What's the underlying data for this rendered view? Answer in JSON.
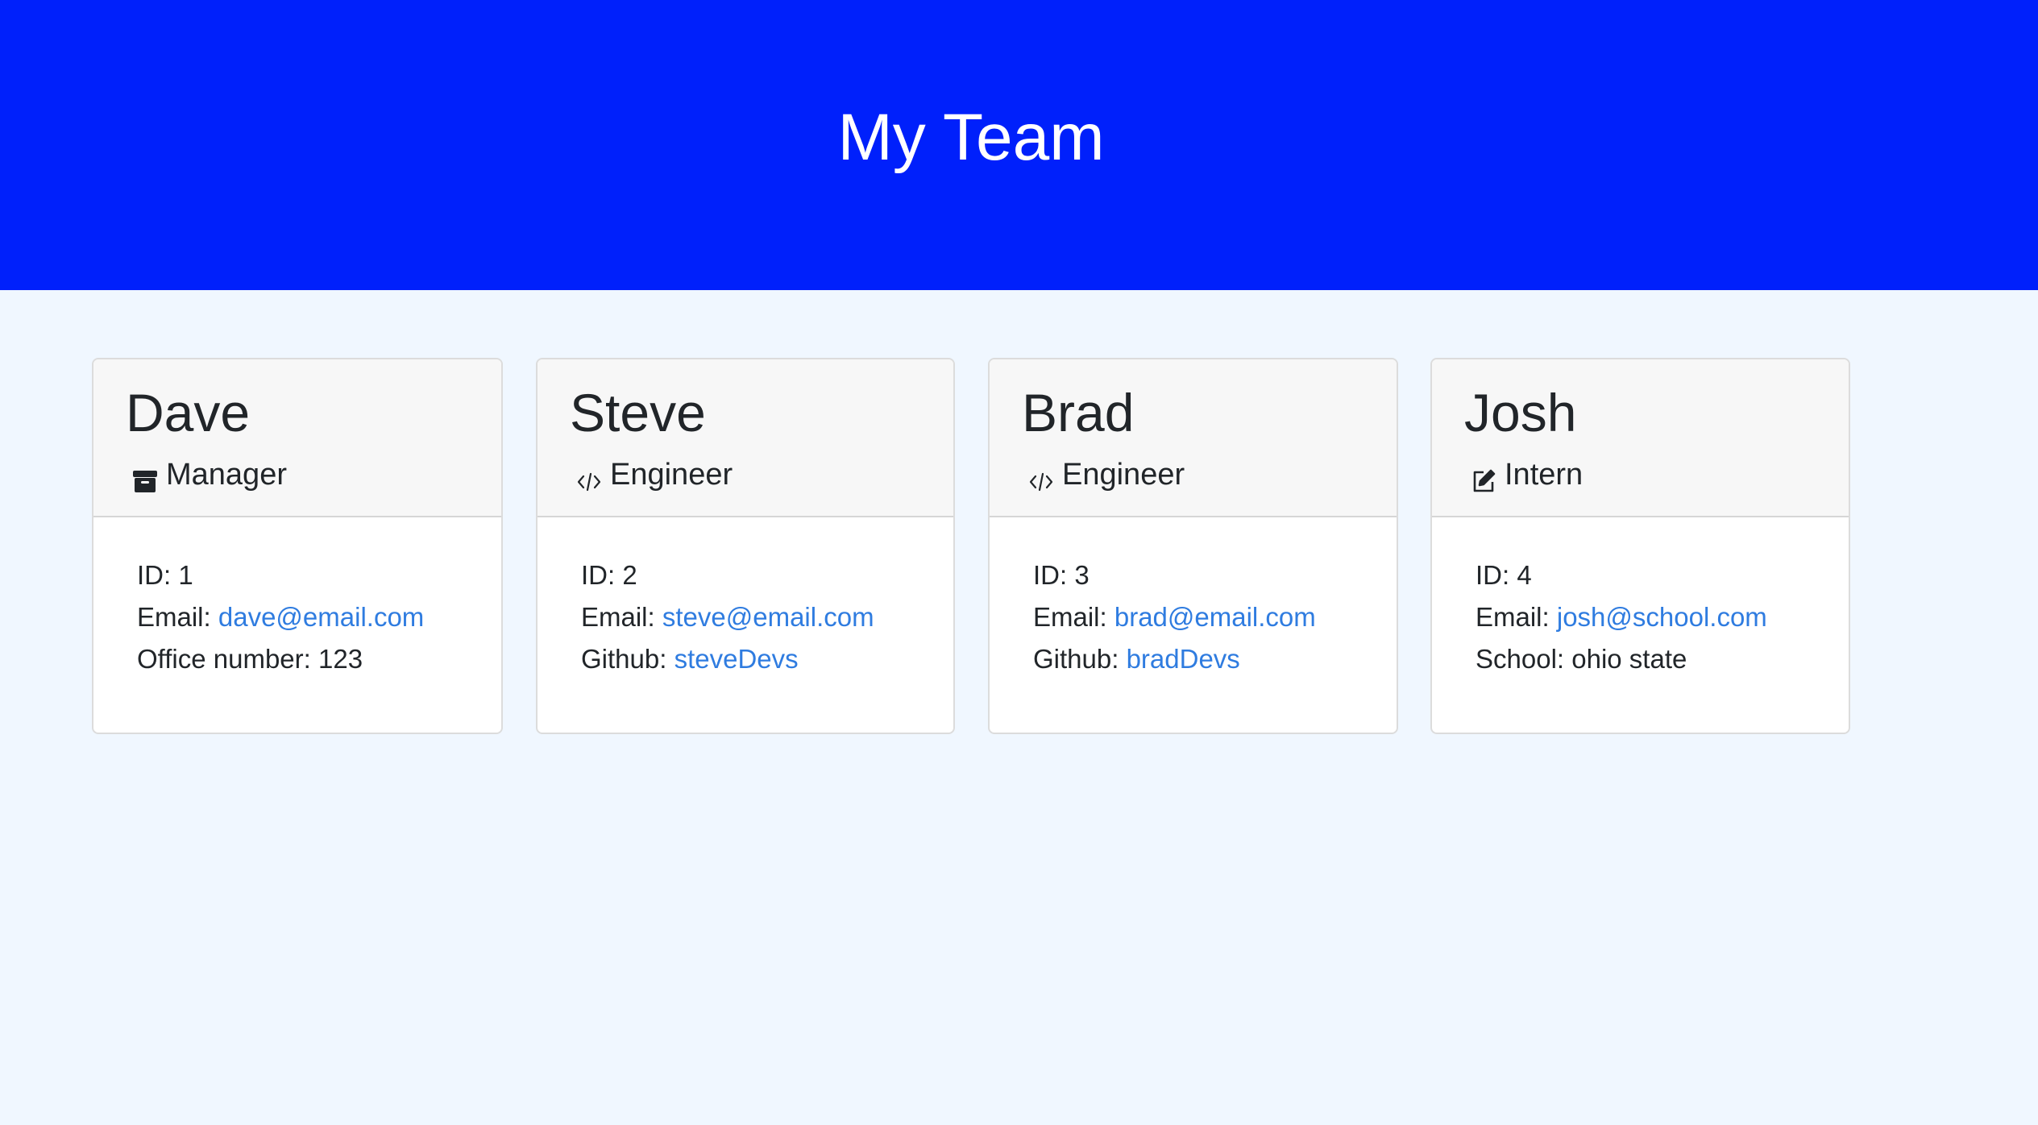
{
  "page": {
    "title": "My Team"
  },
  "labels": {
    "id": "ID:",
    "email": "Email:",
    "office": "Office number:",
    "github": "Github:",
    "school": "School:"
  },
  "team": [
    {
      "name": "Dave",
      "role": "Manager",
      "icon": "archive-icon",
      "id": "1",
      "email": "dave@email.com",
      "extra": "123"
    },
    {
      "name": "Steve",
      "role": "Engineer",
      "icon": "code-icon",
      "id": "2",
      "email": "steve@email.com",
      "extra": "steveDevs"
    },
    {
      "name": "Brad",
      "role": "Engineer",
      "icon": "code-icon",
      "id": "3",
      "email": "brad@email.com",
      "extra": "bradDevs"
    },
    {
      "name": "Josh",
      "role": "Intern",
      "icon": "edit-icon",
      "id": "4",
      "email": "josh@school.com",
      "extra": "ohio state"
    }
  ],
  "colors": {
    "header": "#0020fb",
    "background": "#f0f7ff",
    "link": "#2f7ce0"
  }
}
